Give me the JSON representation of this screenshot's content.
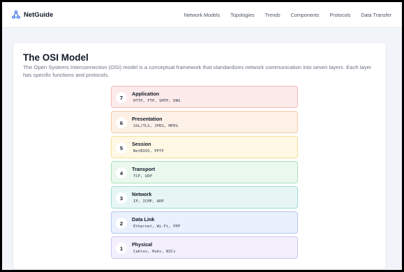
{
  "brand": {
    "name": "NetGuide",
    "icon": "network-nodes-icon",
    "color": "#2563eb"
  },
  "nav": {
    "links": [
      "Network Models",
      "Topologies",
      "Trends",
      "Components",
      "Protocols",
      "Data Transfer"
    ]
  },
  "main": {
    "title": "The OSI Model",
    "description": "The Open Systems Interconnection (OSI) model is a conceptual framework that standardizes network communication into seven layers. Each layer has specific functions and protocols.",
    "layers": [
      {
        "number": "7",
        "name": "Application",
        "protocols": "HTTP, FTP, SMTP, DNS",
        "bg": "#fdeaea",
        "border": "#f6b8b8"
      },
      {
        "number": "6",
        "name": "Presentation",
        "protocols": "SSL/TLS, JPEG, MPEG",
        "bg": "#fdf0e6",
        "border": "#f7c9a2"
      },
      {
        "number": "5",
        "name": "Session",
        "protocols": "NetBIOS, PPTP",
        "bg": "#fef8e4",
        "border": "#f6df97"
      },
      {
        "number": "4",
        "name": "Transport",
        "protocols": "TCP, UDP",
        "bg": "#eaf8ee",
        "border": "#a9e2b9"
      },
      {
        "number": "3",
        "name": "Network",
        "protocols": "IP, ICMP, ARP",
        "bg": "#e7f6f5",
        "border": "#9fdcd6"
      },
      {
        "number": "2",
        "name": "Data Link",
        "protocols": "Ethernet, Wi-Fi, PPP",
        "bg": "#eaf0fc",
        "border": "#b3c8f3"
      },
      {
        "number": "1",
        "name": "Physical",
        "protocols": "Cables, Hubs, NICs",
        "bg": "#f3effc",
        "border": "#d2c3f2"
      }
    ]
  }
}
